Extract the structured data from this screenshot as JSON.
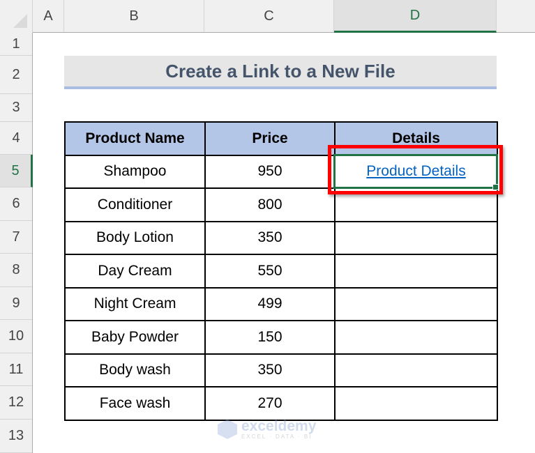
{
  "sheet": {
    "columns": [
      "A",
      "B",
      "C",
      "D"
    ],
    "selected_column": "D",
    "rows": [
      "1",
      "2",
      "3",
      "4",
      "5",
      "6",
      "7",
      "8",
      "9",
      "10",
      "11",
      "12",
      "13"
    ],
    "selected_row": "5"
  },
  "title": "Create a Link to a New File",
  "table": {
    "headers": [
      "Product Name",
      "Price",
      "Details"
    ],
    "rows": [
      {
        "name": "Shampoo",
        "price": "950",
        "details": "Product Details"
      },
      {
        "name": "Conditioner",
        "price": "800",
        "details": ""
      },
      {
        "name": "Body Lotion",
        "price": "350",
        "details": ""
      },
      {
        "name": "Day Cream",
        "price": "550",
        "details": ""
      },
      {
        "name": "Night Cream",
        "price": "499",
        "details": ""
      },
      {
        "name": "Baby Powder",
        "price": "150",
        "details": ""
      },
      {
        "name": "Body wash",
        "price": "350",
        "details": ""
      },
      {
        "name": "Face wash",
        "price": "270",
        "details": ""
      }
    ]
  },
  "active_cell": "D5",
  "colors": {
    "header_fill": "#b4c6e7",
    "title_fill": "#e7e6e6",
    "title_text": "#44546a",
    "link": "#0563c1",
    "selection": "#217346",
    "highlight": "#ff0000"
  },
  "watermark": {
    "name": "exceldemy",
    "tagline": "EXCEL · DATA · BI"
  }
}
